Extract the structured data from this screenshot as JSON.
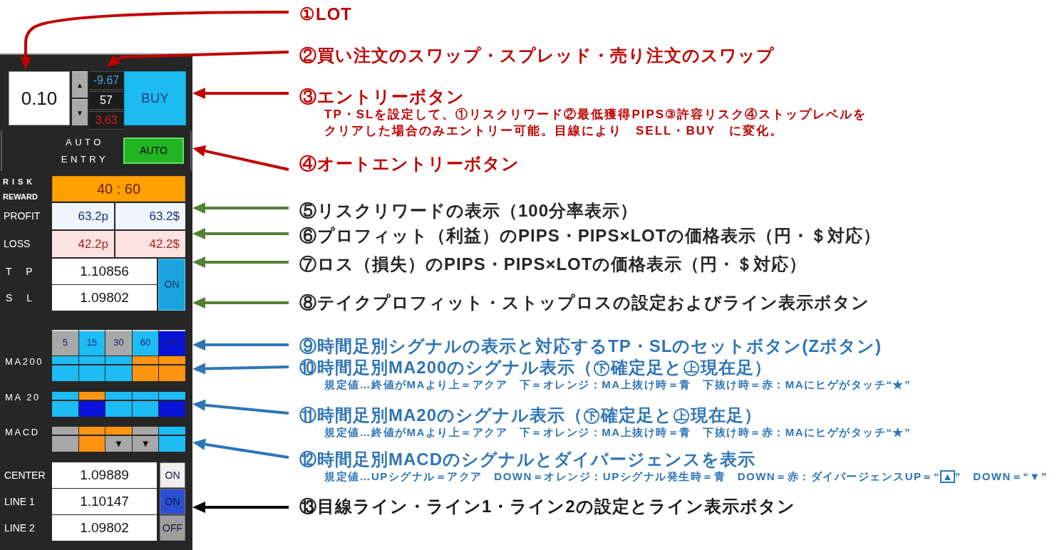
{
  "order_panel": {
    "lot": {
      "value": "0.10"
    },
    "lot_spinner": {
      "up": "▲",
      "down": "▼"
    },
    "quotes": [
      {
        "value": "-9.67",
        "color": "#4aa8d8"
      },
      {
        "value": "57",
        "color": "#ffffff"
      },
      {
        "value": "3.63",
        "color": "#d42020"
      }
    ],
    "entry_button": {
      "label": "BUY"
    },
    "auto_entry": {
      "caption": [
        "AUTO",
        "ENTRY"
      ],
      "button": {
        "label": "AUTO",
        "on": true
      }
    },
    "risk_reward": {
      "labels": [
        "RISK",
        "REWARD"
      ],
      "value": "40 : 60"
    },
    "profit": {
      "label": "PROFIT",
      "pips": "63.2p",
      "amount": "63.2$"
    },
    "loss": {
      "label": "LOSS",
      "pips": "42.2p",
      "amount": "42.2$"
    },
    "take_profit": {
      "label": "T P",
      "value": "1.10856"
    },
    "stop_loss": {
      "label": "S L",
      "value": "1.09802"
    },
    "tp_sl_button": {
      "label": "ON",
      "on": true
    },
    "timeframes": [
      {
        "label": "5",
        "color": "#a8a8a8"
      },
      {
        "label": "15",
        "color": "#1ebcf5"
      },
      {
        "label": "30",
        "color": "#a8a8a8"
      },
      {
        "label": "60",
        "color": "#1ebcf5"
      },
      {
        "label": "240",
        "color": "#0a12d8"
      }
    ],
    "signals": [
      {
        "label": "MA200",
        "cells": [
          {
            "upper": {
              "color": "#1ebcf5"
            },
            "lower": {
              "color": "#1ebcf5"
            }
          },
          {
            "upper": {
              "color": "#1ebcf5"
            },
            "lower": {
              "color": "#1ebcf5"
            }
          },
          {
            "upper": {
              "color": "#1ebcf5"
            },
            "lower": {
              "color": "#1ebcf5"
            }
          },
          {
            "upper": {
              "color": "#ff9410"
            },
            "lower": {
              "color": "#ff9410"
            }
          },
          {
            "upper": {
              "color": "#ff9410"
            },
            "lower": {
              "color": "#ff9410"
            }
          }
        ]
      },
      {
        "label": "MA 20",
        "cells": [
          {
            "upper": {
              "color": "#1ebcf5"
            },
            "lower": {
              "color": "#1ebcf5"
            }
          },
          {
            "upper": {
              "color": "#ff9410"
            },
            "lower": {
              "color": "#0a12d8"
            }
          },
          {
            "upper": {
              "color": "#1ebcf5"
            },
            "lower": {
              "color": "#1ebcf5"
            }
          },
          {
            "upper": {
              "color": "#1ebcf5"
            },
            "lower": {
              "color": "#1ebcf5"
            }
          },
          {
            "upper": {
              "color": "#1ebcf5"
            },
            "lower": {
              "color": "#0a12d8"
            }
          }
        ]
      },
      {
        "label": "MACD",
        "cells": [
          {
            "upper": {
              "color": "#a8a8a8"
            },
            "lower": {
              "color": "#a8a8a8"
            }
          },
          {
            "upper": {
              "color": "#ff9410"
            },
            "lower": {
              "color": "#ff9410"
            }
          },
          {
            "upper": {
              "color": "#ff9410"
            },
            "lower": {
              "color": "#a8a8a8",
              "marker": "▼"
            }
          },
          {
            "upper": {
              "color": "#a8a8a8"
            },
            "lower": {
              "color": "#a8a8a8",
              "marker": "▼"
            }
          },
          {
            "upper": {
              "color": "#1ebcf5"
            },
            "lower": {
              "color": "#1ebcf5"
            }
          }
        ]
      }
    ],
    "lines": [
      {
        "label": "CENTER",
        "value": "1.09889",
        "button": {
          "label": "ON",
          "color": "#efefef"
        }
      },
      {
        "label": "LINE 1",
        "value": "1.10147",
        "button": {
          "label": "ON",
          "color": "#2a4fd4"
        }
      },
      {
        "label": "LINE 2",
        "value": "1.09802",
        "button": {
          "label": "OFF",
          "color": "#9e9e9e"
        }
      }
    ]
  },
  "annotations": [
    {
      "label": "①LOT",
      "color": "#c00000",
      "arrow": {
        "color": "#c00000"
      }
    },
    {
      "label": "②買い注文のスワップ・スプレッド・売り注文のスワップ",
      "color": "#c00000",
      "arrow": {
        "color": "#c00000"
      }
    },
    {
      "label": "③エントリーボタン",
      "color": "#c00000",
      "arrow": {
        "color": "#c00000"
      },
      "notes": [
        [
          {
            "text": "TP・SLを設定して、①リスクリワード②最低獲得PIPS③許容リスク④ストップレベルを",
            "boxed": false
          }
        ],
        [
          {
            "text": "クリアした場合のみエントリー可能。目線により　SELL・BUY　に変化。",
            "boxed": false
          }
        ]
      ]
    },
    {
      "label": "④オートエントリーボタン",
      "color": "#c00000",
      "arrow": {
        "color": "#c00000"
      }
    },
    {
      "label": "⑤リスクリワードの表示（100分率表示）",
      "color": "#262626",
      "arrow": {
        "color": "#548235"
      }
    },
    {
      "label": "⑥プロフィット（利益）のPIPS・PIPS×LOTの価格表示（円・＄対応）",
      "color": "#262626",
      "arrow": {
        "color": "#548235"
      }
    },
    {
      "label": "⑦ロス（損失）のPIPS・PIPS×LOTの価格表示（円・＄対応）",
      "color": "#262626",
      "arrow": {
        "color": "#548235"
      }
    },
    {
      "label": "⑧テイクプロフィット・ストップロスの設定およびライン表示ボタン",
      "color": "#262626",
      "arrow": {
        "color": "#548235"
      }
    },
    {
      "label": "⑨時間足別シグナルの表示と対応するTP・SLのセットボタン(Zボタン)",
      "color": "#2e75b6",
      "arrow": {
        "color": "#2e75b6"
      }
    },
    {
      "label": "⑩時間足別MA200のシグナル表示（㊦確定足と㊤現在足）",
      "color": "#2e75b6",
      "arrow": {
        "color": "#2e75b6"
      },
      "notes": [
        [
          {
            "text": "規定値…終値がMAより上＝アクア　下＝オレンジ：MA上抜け時＝青　下抜け時＝赤：MAにヒゲがタッチ“★”",
            "boxed": false
          }
        ]
      ]
    },
    {
      "label": "⑪時間足別MA20のシグナル表示（㊦確定足と㊤現在足）",
      "color": "#2e75b6",
      "arrow": {
        "color": "#2e75b6"
      },
      "notes": [
        [
          {
            "text": "規定値…終値がMAより上＝アクア　下＝オレンジ：MA上抜け時＝青　下抜け時＝赤：MAにヒゲがタッチ“★”",
            "boxed": false
          }
        ]
      ]
    },
    {
      "label": "⑫時間足別MACDのシグナルとダイバージェンスを表示",
      "color": "#2e75b6",
      "arrow": {
        "color": "#2e75b6"
      },
      "notes": [
        [
          {
            "text": "規定値…UPシグナル＝アクア　DOWN＝オレンジ：UPシグナル発生時＝青　DOWN＝赤：ダイバージェンスUP＝“",
            "boxed": false
          },
          {
            "text": "▲",
            "boxed": true
          },
          {
            "text": "”　DOWN＝“▼”",
            "boxed": false
          }
        ]
      ]
    },
    {
      "label": "⑬目線ライン・ライン1・ライン2の設定とライン表示ボタン",
      "color": "#1a1a1a",
      "arrow": {
        "color": "#000000"
      }
    }
  ]
}
